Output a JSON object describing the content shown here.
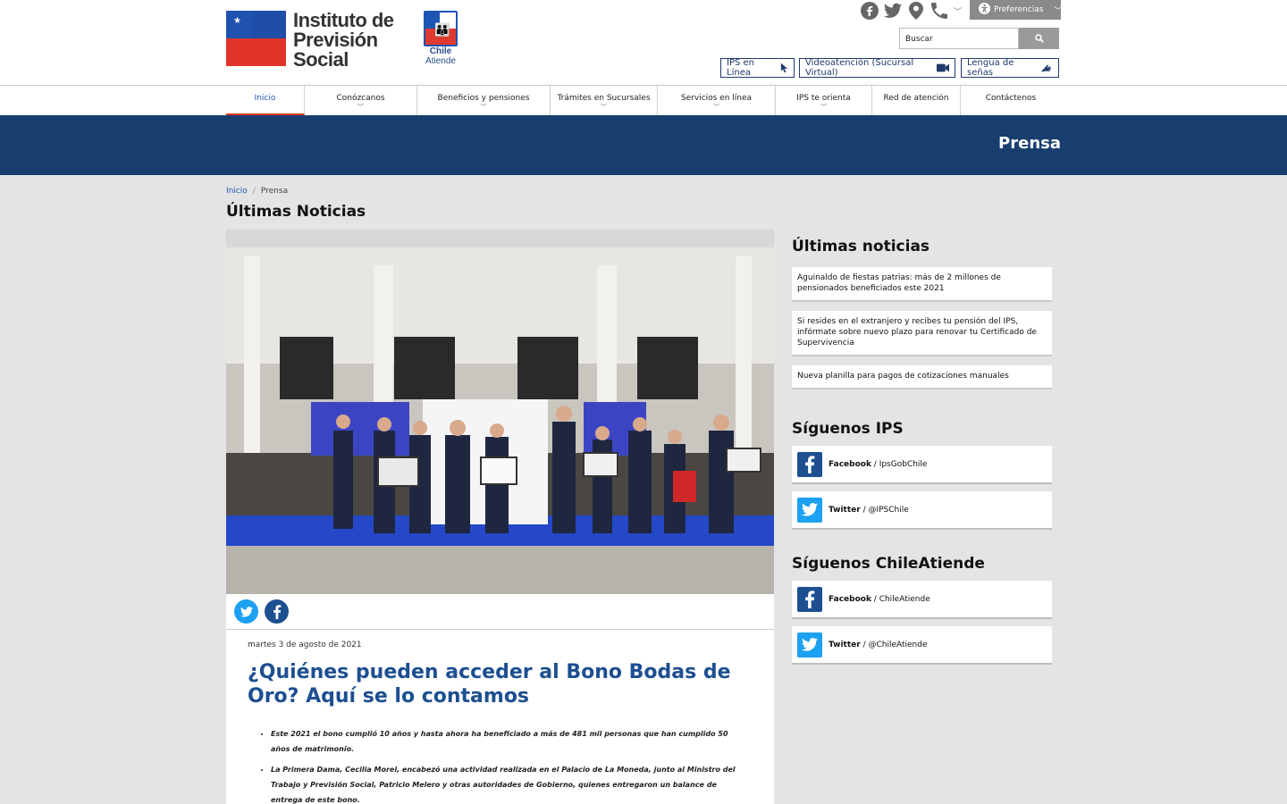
{
  "header": {
    "logo_line1": "Instituto de",
    "logo_line2": "Previsión",
    "logo_line3": "Social",
    "chile_line1": "Chile",
    "chile_line2": "Atiende",
    "preferences_label": "Preferencias",
    "search_placeholder": "Buscar",
    "quick_links": [
      "IPS en Línea",
      "Videoatención (Sucursal Virtual)",
      "Lengua de señas"
    ]
  },
  "nav": {
    "items": [
      {
        "label": "Inicio"
      },
      {
        "label": "Conózcanos"
      },
      {
        "label": "Beneficios y pensiones"
      },
      {
        "label": "Trámites en Sucursales"
      },
      {
        "label": "Servicios en línea"
      },
      {
        "label": "IPS te orienta"
      },
      {
        "label": "Red de atención"
      },
      {
        "label": "Contáctenos"
      }
    ]
  },
  "banner": {
    "title": "Prensa"
  },
  "breadcrumb": {
    "home": "Inicio",
    "sep": "/",
    "current": "Prensa"
  },
  "page_title": "Últimas Noticias",
  "article": {
    "date": "martes 3 de agosto de 2021",
    "title": "¿Quiénes pueden acceder al Bono Bodas de Oro? Aquí se lo contamos",
    "bullets": [
      "Este 2021 el bono cumplió 10 años y hasta ahora ha beneficiado a más de 481 mil personas que han cumplido 50 años de matrimonio.",
      "La Primera Dama, Cecilia Morel, encabezó una actividad realizada en el Palacio de La Moneda, junto al Ministro del Trabajo y Previsión Social, Patricio Melero y otras autoridades de Gobierno, quienes entregaron un balance de entrega de este bono."
    ]
  },
  "sidebar": {
    "news_title": "Últimas noticias",
    "news": [
      "Aguinaldo de fiestas patrias: más de 2 millones de pensionados beneficiados este 2021",
      "Si resides en el extranjero y recibes tu pensión del IPS, infórmate sobre nuevo plazo para renovar tu Certificado de Supervivencia",
      "Nueva planilla para pagos de cotizaciones manuales"
    ],
    "follow_ips_title": "Síguenos IPS",
    "follow_ips": [
      {
        "network": "Facebook",
        "handle": " / IpsGobChile"
      },
      {
        "network": "Twitter",
        "handle": " / @IPSChile"
      }
    ],
    "follow_ca_title": "Síguenos ChileAtiende",
    "follow_ca": [
      {
        "network": "Facebook",
        "handle": " / ChileAtiende"
      },
      {
        "network": "Twitter",
        "handle": " / @ChileAtiende"
      }
    ]
  },
  "colors": {
    "banner": "#173e6f",
    "link": "#1d55b5",
    "title": "#1d4f91",
    "facebook": "#1d4f91",
    "twitter": "#1da1f2"
  }
}
